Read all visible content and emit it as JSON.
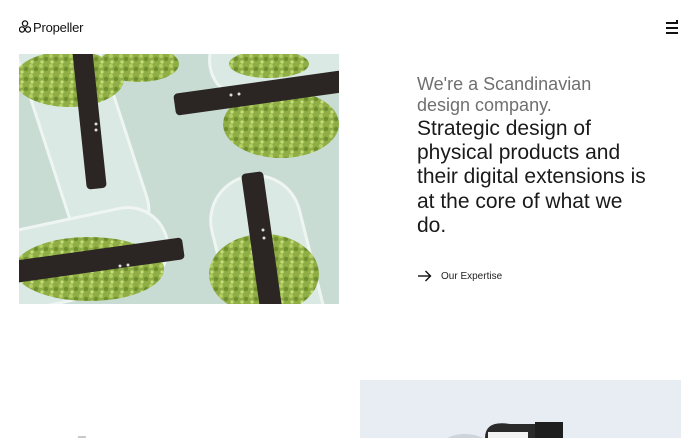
{
  "header": {
    "logo_text": "Propeller",
    "logo_icon": "propeller-logo-icon",
    "menu_icon": "hamburger-menu-icon"
  },
  "hero": {
    "image_description_icon": "product-photo"
  },
  "content": {
    "intro": "We're a Scandinavian design company.",
    "statement": "Strategic design of physical products and their digital extensions is at the core of what we do.",
    "cta_label": "Our Expertise",
    "cta_icon": "arrow-right-icon"
  },
  "colors": {
    "background": "#ffffff",
    "intro_text": "#6f6f6f",
    "body_text": "#1a1a1a",
    "bottom_card": "#e8ecf3"
  }
}
